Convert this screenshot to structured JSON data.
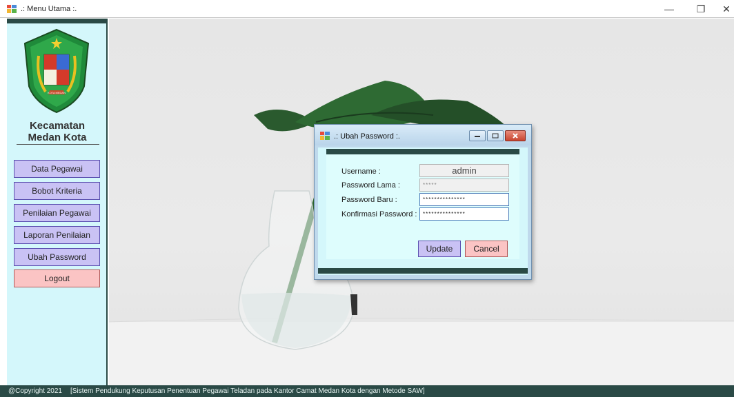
{
  "window": {
    "title": ".: Menu Utama :.",
    "min_glyph": "—",
    "max_glyph": "❐",
    "close_glyph": "✕"
  },
  "sidebar": {
    "org_line1": "Kecamatan",
    "org_line2": "Medan Kota",
    "logo_text": "KOTA MEDAN",
    "items": [
      {
        "label": "Data Pegawai"
      },
      {
        "label": "Bobot Kriteria"
      },
      {
        "label": "Penilaian Pegawai"
      },
      {
        "label": "Laporan Penilaian"
      },
      {
        "label": "Ubah Password"
      },
      {
        "label": "Logout"
      }
    ]
  },
  "status": {
    "copyright": "@Copyright 2021",
    "text": "[Sistem Pendukung Keputusan Penentuan Pegawai Teladan pada Kantor Camat Medan Kota dengan Metode SAW]"
  },
  "dialog": {
    "title": ".: Ubah Password :.",
    "labels": {
      "username": "Username :",
      "old_password": "Password Lama :",
      "new_password": "Password Baru :",
      "confirm_password": "Konfirmasi Password :"
    },
    "values": {
      "username": "admin",
      "old_password": "*****",
      "new_password": "***************",
      "confirm_password": "***************"
    },
    "buttons": {
      "update": "Update",
      "cancel": "Cancel"
    }
  },
  "colors": {
    "sidebar_bg": "#d4f7fb",
    "dark_band": "#2a4a46",
    "nav_button": "#c9c2f4",
    "logout_button": "#fbc4c4"
  }
}
